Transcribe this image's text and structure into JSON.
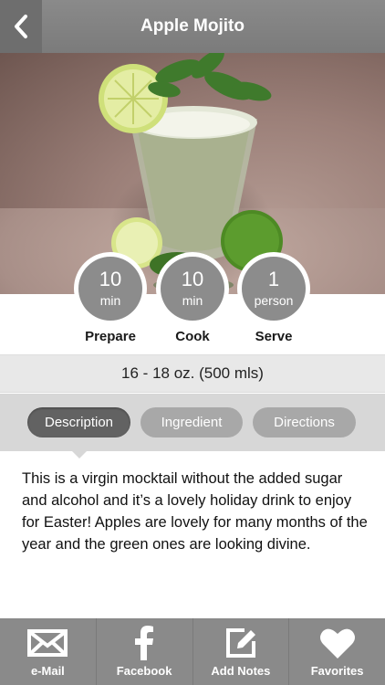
{
  "header": {
    "title": "Apple Mojito",
    "back_icon": "chevron-left-icon"
  },
  "stats": [
    {
      "value": "10",
      "unit": "min",
      "label": "Prepare"
    },
    {
      "value": "10",
      "unit": "min",
      "label": "Cook"
    },
    {
      "value": "1",
      "unit": "person",
      "label": "Serve"
    }
  ],
  "serving": "16 - 18 oz. (500 mls)",
  "tabs": [
    {
      "label": "Description",
      "active": true
    },
    {
      "label": "Ingredient",
      "active": false
    },
    {
      "label": "Directions",
      "active": false
    }
  ],
  "description": "This is a virgin mocktail without the added sugar and alcohol and it’s a lovely holiday drink to enjoy for Easter! Apples are lovely for many months of the year and the green ones are looking divine.",
  "toolbar": [
    {
      "label": "e-Mail",
      "icon": "email-icon"
    },
    {
      "label": "Facebook",
      "icon": "facebook-icon"
    },
    {
      "label": "Add Notes",
      "icon": "add-notes-icon"
    },
    {
      "label": "Favorites",
      "icon": "heart-icon"
    }
  ]
}
